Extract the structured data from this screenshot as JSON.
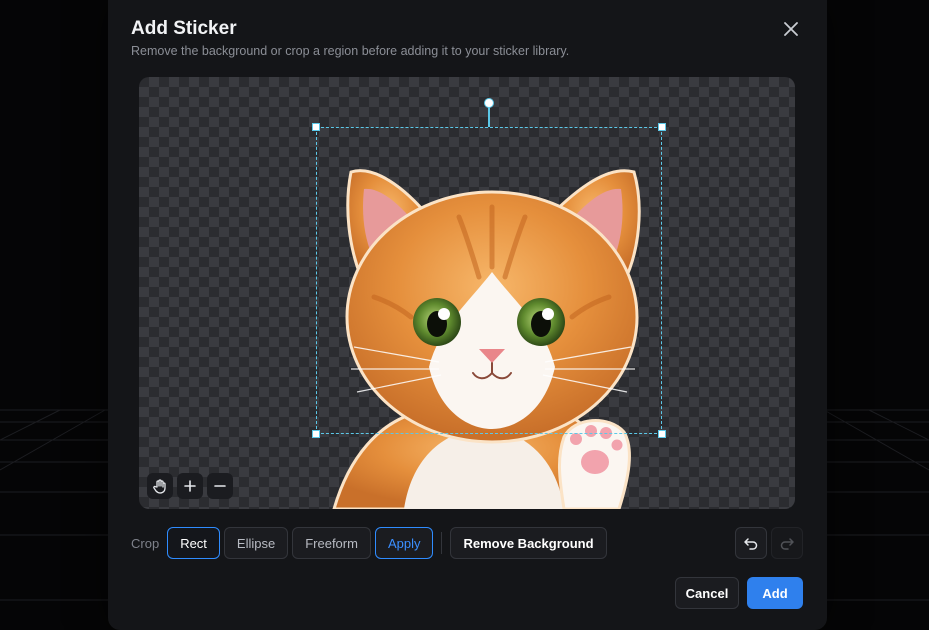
{
  "dialog": {
    "title": "Add Sticker",
    "subtitle": "Remove the background or crop a region before adding it to your sticker library.",
    "close_icon": "close-icon"
  },
  "canvas": {
    "content": "cat-sticker-image",
    "tools": [
      "hand-icon",
      "zoom-in-icon",
      "zoom-out-icon"
    ]
  },
  "crop": {
    "label": "Crop",
    "modes": [
      {
        "label": "Rect",
        "active": true
      },
      {
        "label": "Ellipse",
        "active": false
      },
      {
        "label": "Freeform",
        "active": false
      }
    ],
    "apply_label": "Apply",
    "remove_bg_label": "Remove Background",
    "undo_icon": "undo-icon",
    "redo_icon": "redo-icon"
  },
  "footer": {
    "cancel_label": "Cancel",
    "add_label": "Add"
  },
  "colors": {
    "accent": "#2f80ed",
    "crop_outline": "#5cc8e8",
    "modal_bg": "#141518"
  }
}
